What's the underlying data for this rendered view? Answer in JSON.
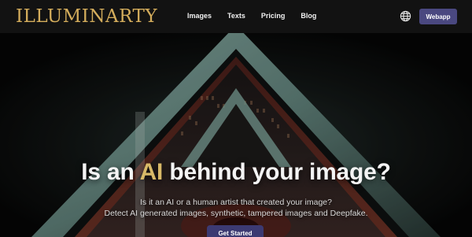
{
  "brand": {
    "logo_text": "ILLUMINARTY"
  },
  "nav": {
    "items": [
      {
        "label": "Images"
      },
      {
        "label": "Texts"
      },
      {
        "label": "Pricing"
      },
      {
        "label": "Blog"
      }
    ],
    "language_icon": "globe-icon",
    "webapp_label": "Webapp"
  },
  "hero": {
    "headline_prefix": "Is an ",
    "headline_accent": "AI",
    "headline_suffix": " behind your image?",
    "subtitle_line1": "Is it an AI or a human artist that created your image?",
    "subtitle_line2": "Detect AI generated images, synthetic, tampered images and Deepfake.",
    "cta_label": "Get Started"
  },
  "colors": {
    "brand_gold": "#d4ad5c",
    "accent_gold": "#d8b968",
    "button_purple": "#4a4880",
    "navbar_bg": "#121212"
  }
}
